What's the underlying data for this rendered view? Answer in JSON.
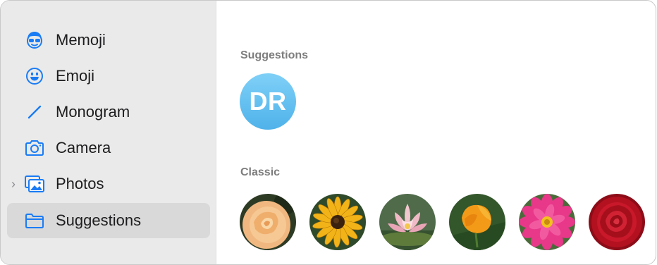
{
  "sidebar": {
    "items": [
      {
        "label": "Memoji",
        "icon": "memoji-icon"
      },
      {
        "label": "Emoji",
        "icon": "emoji-icon"
      },
      {
        "label": "Monogram",
        "icon": "pencil-icon"
      },
      {
        "label": "Camera",
        "icon": "camera-icon"
      },
      {
        "label": "Photos",
        "icon": "photos-icon"
      },
      {
        "label": "Suggestions",
        "icon": "folder-icon"
      }
    ],
    "selected": "Suggestions"
  },
  "main": {
    "suggestions_title": "Suggestions",
    "monogram_initials": "DR",
    "classic_title": "Classic",
    "classic_items": [
      "rose-orange",
      "black-eyed-susan",
      "water-lily",
      "california-poppy",
      "zinnia-pink",
      "rose-red"
    ]
  },
  "colors": {
    "accent": "#1a7cf5",
    "sidebar_bg": "#eaeaea",
    "selected_bg": "#d9d9d9",
    "monogram": "#5cbcf0"
  }
}
